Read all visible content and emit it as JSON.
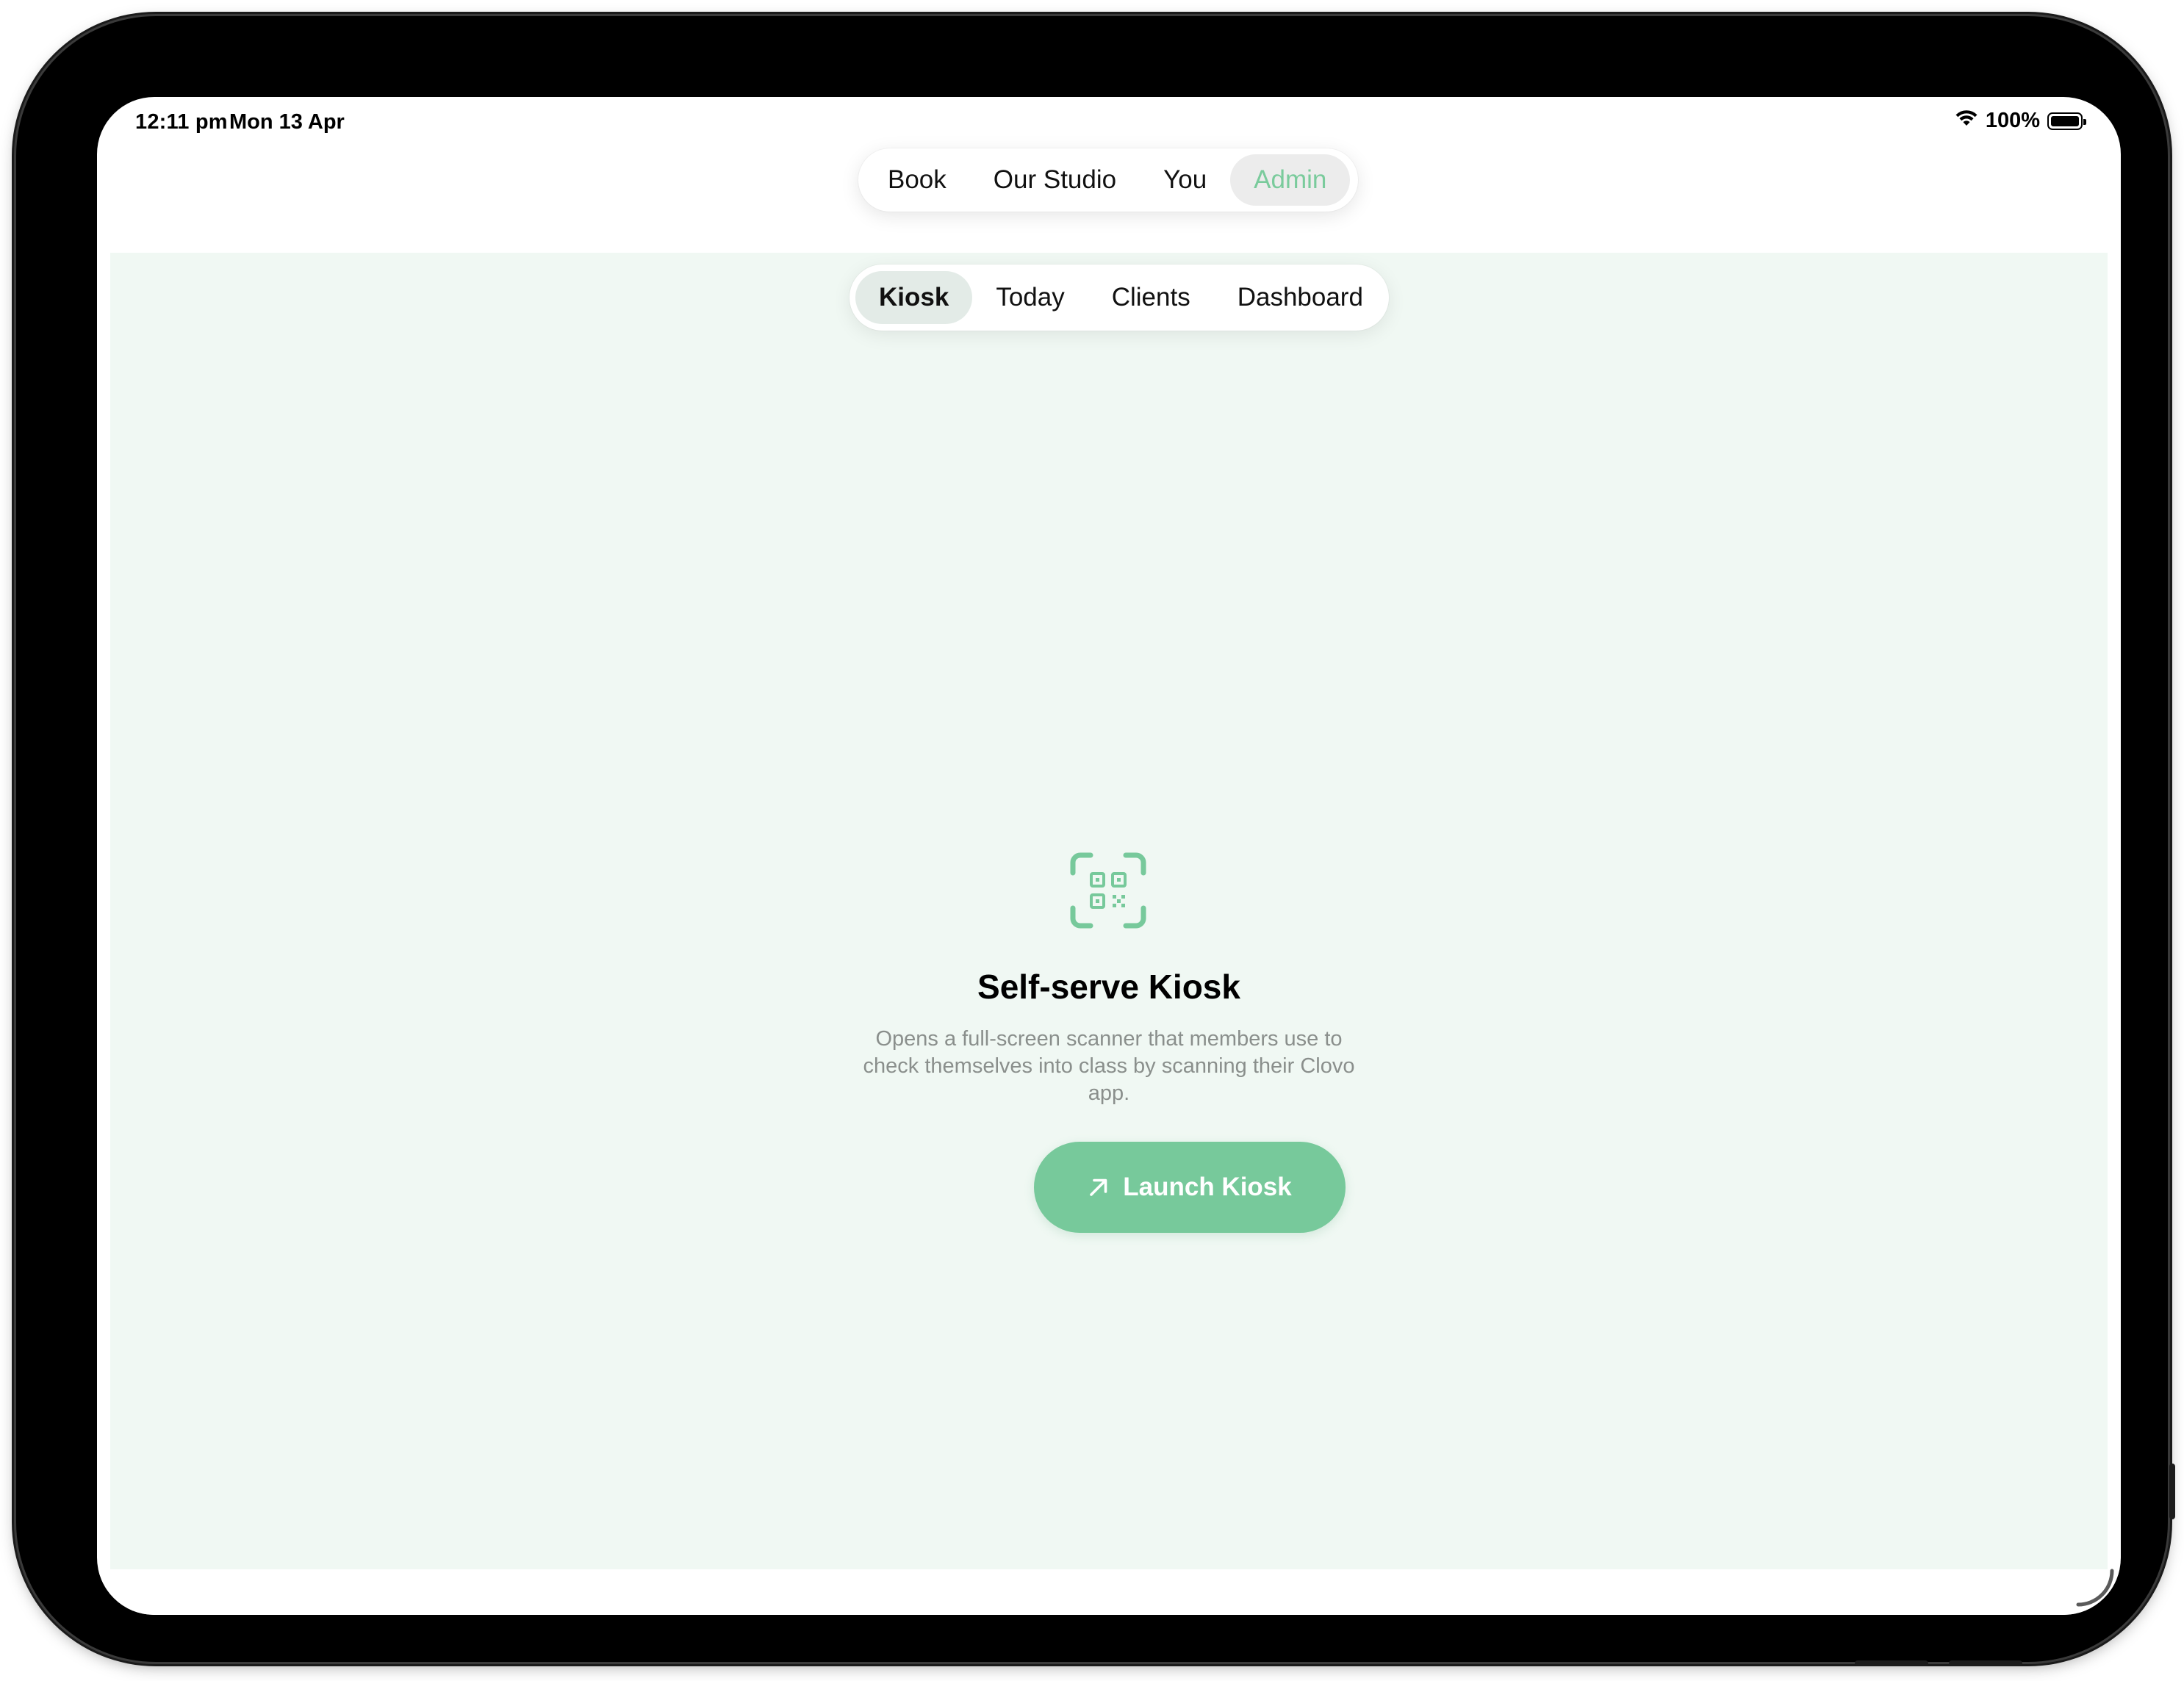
{
  "status_bar": {
    "time": "12:11 pm",
    "date": "Mon 13 Apr",
    "battery": "100%",
    "wifi_icon": "wifi-icon",
    "battery_icon": "battery-icon"
  },
  "top_nav": {
    "items": [
      {
        "label": "Book",
        "active": false
      },
      {
        "label": "Our Studio",
        "active": false
      },
      {
        "label": "You",
        "active": false
      },
      {
        "label": "Admin",
        "active": true
      }
    ]
  },
  "sub_nav": {
    "items": [
      {
        "label": "Kiosk",
        "active": true
      },
      {
        "label": "Today",
        "active": false
      },
      {
        "label": "Clients",
        "active": false
      },
      {
        "label": "Dashboard",
        "active": false
      }
    ]
  },
  "kiosk": {
    "icon": "qr-scan-icon",
    "title": "Self-serve Kiosk",
    "description": "Opens a full-screen scanner that members use to check themselves into class by scanning their Clovo app.",
    "button_label": "Launch Kiosk",
    "button_icon": "arrow-up-right-icon"
  },
  "colors": {
    "accent": "#77c99b",
    "content_background": "#f0f8f3",
    "muted_text": "#8a8f8c"
  }
}
